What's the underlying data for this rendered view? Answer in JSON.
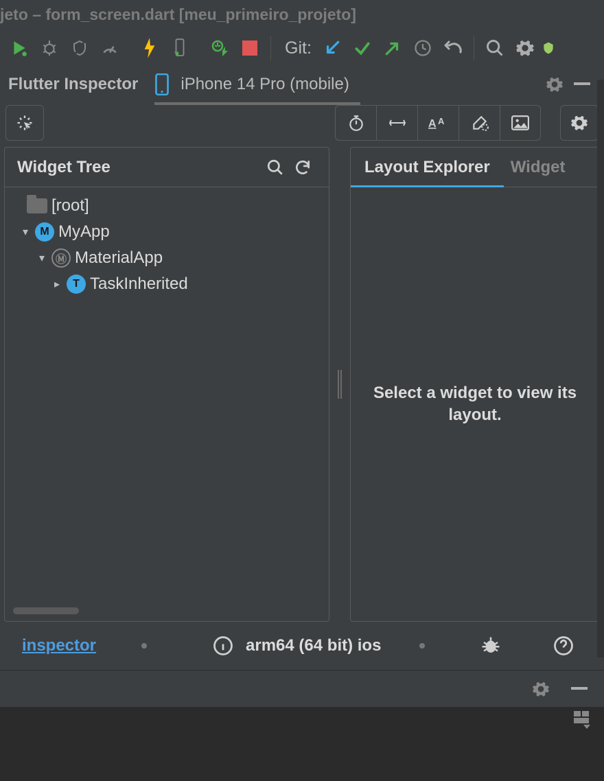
{
  "window": {
    "title": "jeto – form_screen.dart [meu_primeiro_projeto]"
  },
  "toolbar": {
    "git_label": "Git:"
  },
  "panel": {
    "tab_inspector": "Flutter Inspector",
    "device_label": "iPhone 14 Pro (mobile)"
  },
  "tree": {
    "title": "Widget Tree",
    "nodes": {
      "root": "[root]",
      "myapp": "MyApp",
      "material": "MaterialApp",
      "taskinh": "TaskInherited"
    }
  },
  "explorer": {
    "tab_layout": "Layout Explorer",
    "tab_widget": "Widget",
    "empty_text": "Select a widget to view its layout."
  },
  "status": {
    "inspector_link": "inspector",
    "arch": "arm64 (64 bit) ios"
  }
}
